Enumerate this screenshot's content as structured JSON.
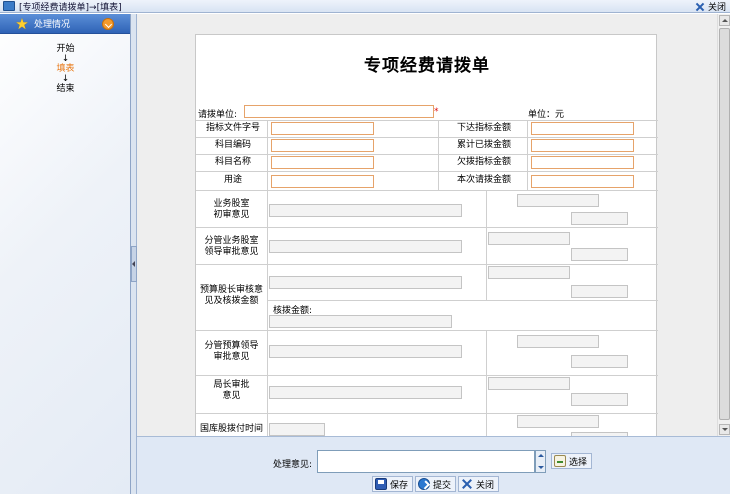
{
  "window": {
    "title": "[专项经费请拨单]→[填表]",
    "close_label": "关闭"
  },
  "sidebar": {
    "header": "处理情况",
    "steps": {
      "start": "开始",
      "arrow": "↓",
      "current": "填表",
      "end": "结束"
    }
  },
  "form": {
    "title": "专项经费请拨单",
    "applicant_unit_label": "请拨单位:",
    "required_mark": "*",
    "unit_label": "单位：元",
    "fields": {
      "doc_no": "指标文件字号",
      "subject_code": "科目编码",
      "subject_name": "科目名称",
      "purpose": "用途",
      "issued_amount": "下达指标金额",
      "cumulative_amount": "累计已拨金额",
      "owed_amount": "欠拨指标金额",
      "current_amount": "本次请拨金额"
    },
    "sections": {
      "business_review": [
        "业务股室",
        "初审意见"
      ],
      "branch_leader": [
        "分管业务股室",
        "领导审批意见"
      ],
      "budget_review": [
        "预算股长审核意",
        "见及核拨金额"
      ],
      "approved_amount_label": "核拨金额:",
      "budget_leader": [
        "分管预算领导",
        "审批意见"
      ],
      "director": [
        "局长审批",
        "意见"
      ],
      "treasury_time": "国库股拨付时间"
    }
  },
  "bottom": {
    "opinion_label": "处理意见:",
    "choose_label": "选择",
    "save_label": "保存",
    "submit_label": "提交",
    "close_label": "关闭"
  }
}
